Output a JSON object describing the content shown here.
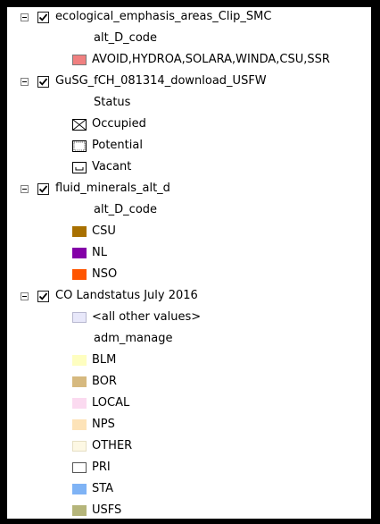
{
  "layers": [
    {
      "name": "ecological_emphasis_areas_Clip_SMC",
      "field": "alt_D_code",
      "items": [
        {
          "label": "AVOID,HYDROA,SOLARA,WINDA,CSU,SSR",
          "color": "#f08080",
          "border": "#7a7a7a"
        }
      ]
    },
    {
      "name": "GuSG_fCH_081314_download_USFW",
      "field": "Status",
      "items": [
        {
          "label": "Occupied",
          "symbol": "crossed-box-icon"
        },
        {
          "label": "Potential",
          "symbol": "dotted-box-icon"
        },
        {
          "label": "Vacant",
          "symbol": "bracket-box-icon"
        }
      ]
    },
    {
      "name": "fluid_minerals_alt_d",
      "field": "alt_D_code",
      "items": [
        {
          "label": "CSU",
          "color": "#a87000"
        },
        {
          "label": "NL",
          "color": "#8400a8"
        },
        {
          "label": "NSO",
          "color": "#ff5500"
        }
      ]
    },
    {
      "name": "CO Landstatus July 2016",
      "other": {
        "label": "<all other values>",
        "color": "#e8e8fa"
      },
      "field": "adm_manage",
      "items": [
        {
          "label": "BLM",
          "color": "#fefec0"
        },
        {
          "label": "BOR",
          "color": "#d6b97f"
        },
        {
          "label": "LOCAL",
          "color": "#fbdaf0"
        },
        {
          "label": "NPS",
          "color": "#fde3b8"
        },
        {
          "label": "OTHER",
          "color": "#fdf8e4"
        },
        {
          "label": "PRI",
          "color": "#ffffff"
        },
        {
          "label": "STA",
          "color": "#7fb3f5"
        },
        {
          "label": "USFS",
          "color": "#b5b57a"
        }
      ]
    }
  ]
}
